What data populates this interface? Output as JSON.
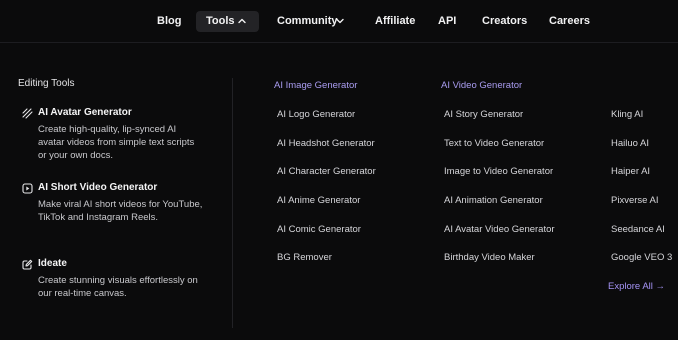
{
  "nav": {
    "blog": "Blog",
    "tools": "Tools",
    "community": "Community",
    "affiliate": "Affiliate",
    "api": "API",
    "creators": "Creators",
    "careers": "Careers"
  },
  "editing": {
    "title": "Editing Tools",
    "tools": [
      {
        "title": "AI Avatar Generator",
        "desc": "Create high-quality, lip-synced AI avatar videos from simple text scripts or your own docs.",
        "icon": "avatar-generator-icon"
      },
      {
        "title": "AI Short Video Generator",
        "desc": "Make viral AI short videos for YouTube, TikTok and Instagram Reels.",
        "icon": "short-video-icon"
      },
      {
        "title": "Ideate",
        "desc": "Create stunning visuals effortlessly on our real-time canvas.",
        "icon": "ideate-edit-icon"
      }
    ]
  },
  "image_col": {
    "title": "AI Image Generator",
    "items": [
      "AI Logo Generator",
      "AI Headshot Generator",
      "AI Character Generator",
      "AI Anime Generator",
      "AI Comic Generator",
      "BG Remover"
    ]
  },
  "video_col": {
    "title": "AI Video Generator",
    "items": [
      "AI Story Generator",
      "Text to Video Generator",
      "Image to Video Generator",
      "AI Animation Generator",
      "AI Avatar Video Generator",
      "Birthday Video Maker"
    ]
  },
  "models_col": {
    "items": [
      "Kling AI",
      "Hailuo AI",
      "Haiper AI",
      "Pixverse AI",
      "Seedance AI",
      "Google VEO 3"
    ],
    "explore": "Explore All →"
  },
  "colors": {
    "background": "#0b0b0c",
    "accent": "#a99cf0",
    "active_nav_bg": "#232326"
  }
}
